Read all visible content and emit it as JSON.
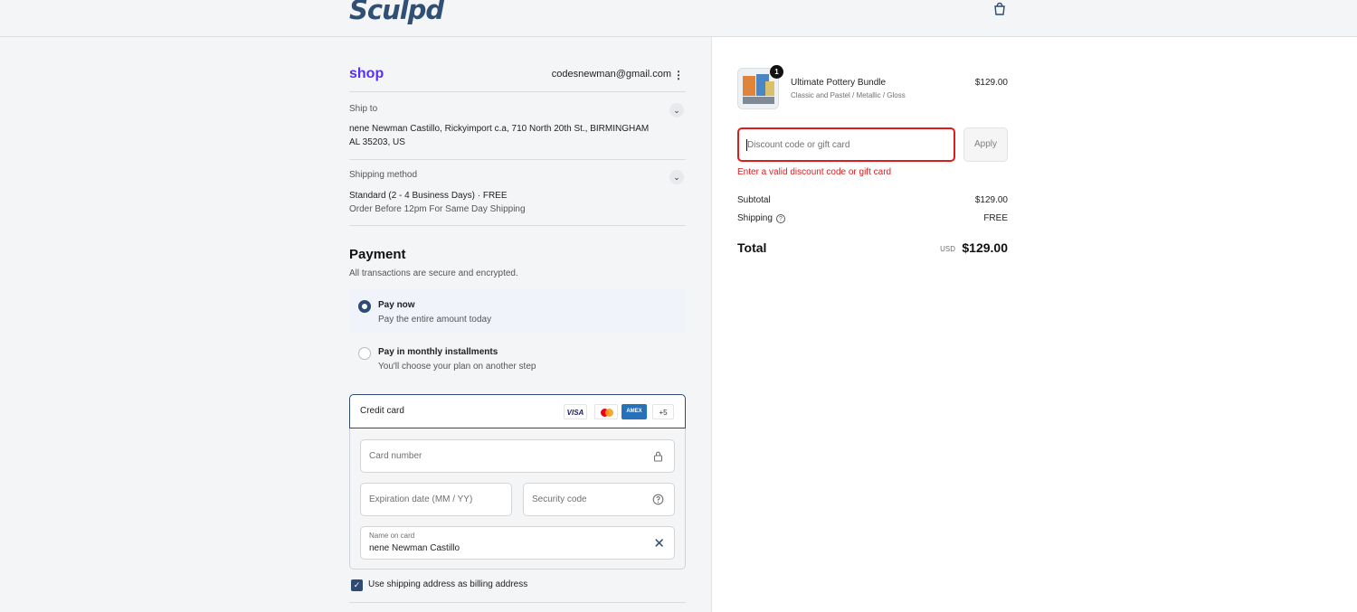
{
  "header": {
    "logo_text": "Sculpd",
    "cart_icon": "shopping-bag-icon"
  },
  "account": {
    "shop_label": "shop",
    "email": "codesnewman@gmail.com",
    "menu_icon": "kebab-menu-icon"
  },
  "ship_to": {
    "label": "Ship to",
    "address_line1": "nene Newman Castillo, Rickyimport c.a, 710 North 20th St., BIRMINGHAM",
    "address_line2": "AL 35203, US"
  },
  "shipping_method": {
    "label": "Shipping method",
    "method": "Standard (2 - 4 Business Days) · FREE",
    "note": "Order Before 12pm For Same Day Shipping"
  },
  "payment": {
    "title": "Payment",
    "subtitle": "All transactions are secure and encrypted.",
    "options": [
      {
        "title": "Pay now",
        "subtitle": "Pay the entire amount today",
        "selected": true
      },
      {
        "title": "Pay in monthly installments",
        "subtitle": "You'll choose your plan on another step",
        "selected": false
      }
    ],
    "credit_card": {
      "label": "Credit card",
      "brands": [
        "VISA",
        "AMEX",
        "+5"
      ],
      "card_number_placeholder": "Card number",
      "expiration_placeholder": "Expiration date (MM / YY)",
      "security_placeholder": "Security code",
      "name_label": "Name on card",
      "name_value": "nene Newman Castillo"
    },
    "billing_checkbox_label": "Use shipping address as billing address",
    "billing_checked": true
  },
  "summary": {
    "product": {
      "quantity": "1",
      "name": "Ultimate Pottery Bundle",
      "variant": "Classic and Pastel / Metallic / Gloss",
      "price": "$129.00"
    },
    "discount_placeholder": "Discount code or gift card",
    "apply_label": "Apply",
    "error": "Enter a valid discount code or gift card",
    "subtotal_label": "Subtotal",
    "subtotal_value": "$129.00",
    "shipping_label": "Shipping",
    "shipping_value": "FREE",
    "total_label": "Total",
    "currency": "USD",
    "total_value": "$129.00"
  },
  "colors": {
    "accent": "#2d4b73",
    "shop_purple": "#5a31f4",
    "error": "#dd1d1d"
  }
}
